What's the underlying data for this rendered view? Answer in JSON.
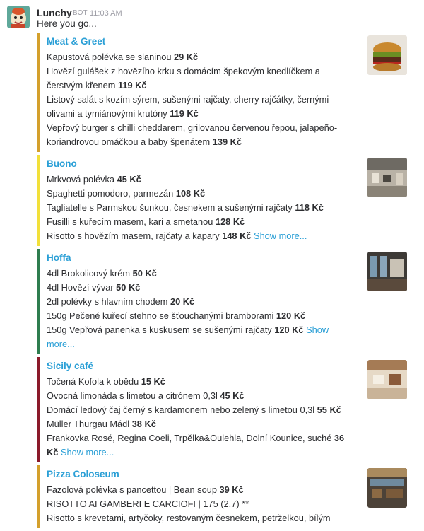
{
  "message": {
    "author": "Lunchy",
    "badge": "BOT",
    "time": "11:03 AM",
    "intro": "Here you go..."
  },
  "restaurants": [
    {
      "name": "Meat & Greet",
      "color": "#d4a02c",
      "items": [
        {
          "text": "Kapustová polévka se slaninou ",
          "price": "29 Kč"
        },
        {
          "text": "Hovězí gulášek z hovězího krku s domácím špekovým knedlíčkem a čerstvým křenem ",
          "price": "119 Kč"
        },
        {
          "text": "Listový salát s kozím sýrem, sušenými rajčaty, cherry rajčátky, černými olivami a tymiánovými krutóny ",
          "price": "119 Kč"
        },
        {
          "text": "Vepřový burger s chilli cheddarem, grilovanou červenou řepou, jalapeño-koriandrovou omáčkou a baby špenátem ",
          "price": "139 Kč"
        }
      ]
    },
    {
      "name": "Buono",
      "color": "#f2e03a",
      "items": [
        {
          "text": "Mrkvová polévka ",
          "price": "45 Kč"
        },
        {
          "text": "Spaghetti pomodoro, parmezán ",
          "price": "108 Kč"
        },
        {
          "text": "Tagliatelle s Parmskou šunkou, česnekem a sušenými rajčaty ",
          "price": "118 Kč"
        },
        {
          "text": "Fusilli s kuřecím masem, kari a smetanou ",
          "price": "128 Kč"
        },
        {
          "text": "Risotto s hovězím masem, rajčaty a kapary ",
          "price": "148 Kč",
          "more": "Show more..."
        }
      ]
    },
    {
      "name": "Hoffa",
      "color": "#2e7d4f",
      "items": [
        {
          "text": "4dl Brokolicový krém ",
          "price": "50 Kč"
        },
        {
          "text": "4dl Hovězí vývar ",
          "price": "50 Kč"
        },
        {
          "text": "2dl polévky s hlavním chodem ",
          "price": "20 Kč"
        },
        {
          "text": "150g Pečené kuřecí stehno se šťouchanými bramborami ",
          "price": "120 Kč"
        },
        {
          "text": "150g Vepřová panenka s kuskusem se sušenými rajčaty ",
          "price": "120 Kč",
          "more": "Show more..."
        }
      ]
    },
    {
      "name": "Sicily café",
      "color": "#8b1a2a",
      "items": [
        {
          "text": "Točená Kofola k obědu ",
          "price": "15 Kč"
        },
        {
          "text": "Ovocná limonáda s limetou a citrónem 0,3l ",
          "price": "45 Kč"
        },
        {
          "text": "Domácí ledový čaj černý s kardamonem nebo zelený s limetou 0,3l ",
          "price": "55 Kč"
        },
        {
          "text": "Müller Thurgau Mádl ",
          "price": "38 Kč"
        },
        {
          "text": "Frankovka Rosé, Regina Coeli, Trpělka&Oulehla, Dolní Kounice, suché ",
          "price": "36 Kč",
          "more": "Show more..."
        }
      ]
    },
    {
      "name": "Pizza Coloseum",
      "color": "#d4a02c",
      "items": [
        {
          "text": "Fazolová polévka s pancettou | Bean soup ",
          "price": "39 Kč"
        },
        {
          "text": "RISOTTO AI GAMBERI E CARCIOFI | 175 (2,7) **",
          "price": ""
        },
        {
          "text": "Risotto s krevetami, artyčoky, restovaným česnekem, petrželkou, bílým",
          "price": ""
        }
      ]
    }
  ]
}
